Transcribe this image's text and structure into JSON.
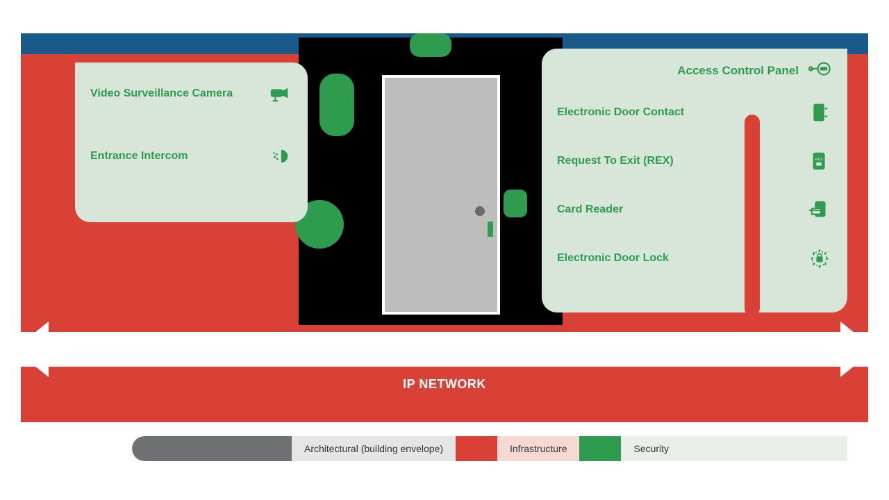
{
  "network_label": "IP NETWORK",
  "acp_title": "Access Control Panel",
  "left_panel": {
    "items": [
      {
        "label": "Video Surveillance Camera",
        "icon": "camera"
      },
      {
        "label": "Entrance Intercom",
        "icon": "intercom"
      }
    ]
  },
  "right_panel": {
    "items": [
      {
        "label": "Electronic Door Contact",
        "icon": "door-contact"
      },
      {
        "label": "Request To Exit (REX)",
        "icon": "rex"
      },
      {
        "label": "Card Reader",
        "icon": "card-reader"
      },
      {
        "label": "Electronic Door Lock",
        "icon": "door-lock"
      }
    ]
  },
  "legend": {
    "arch": "Architectural (building envelope)",
    "infra": "Infrastructure",
    "sec": "Security"
  },
  "colors": {
    "blue": "#1a5a8a",
    "red": "#d94136",
    "green": "#2e9b4f",
    "panel": "#d7e6d8",
    "grey": "#6f7072"
  }
}
